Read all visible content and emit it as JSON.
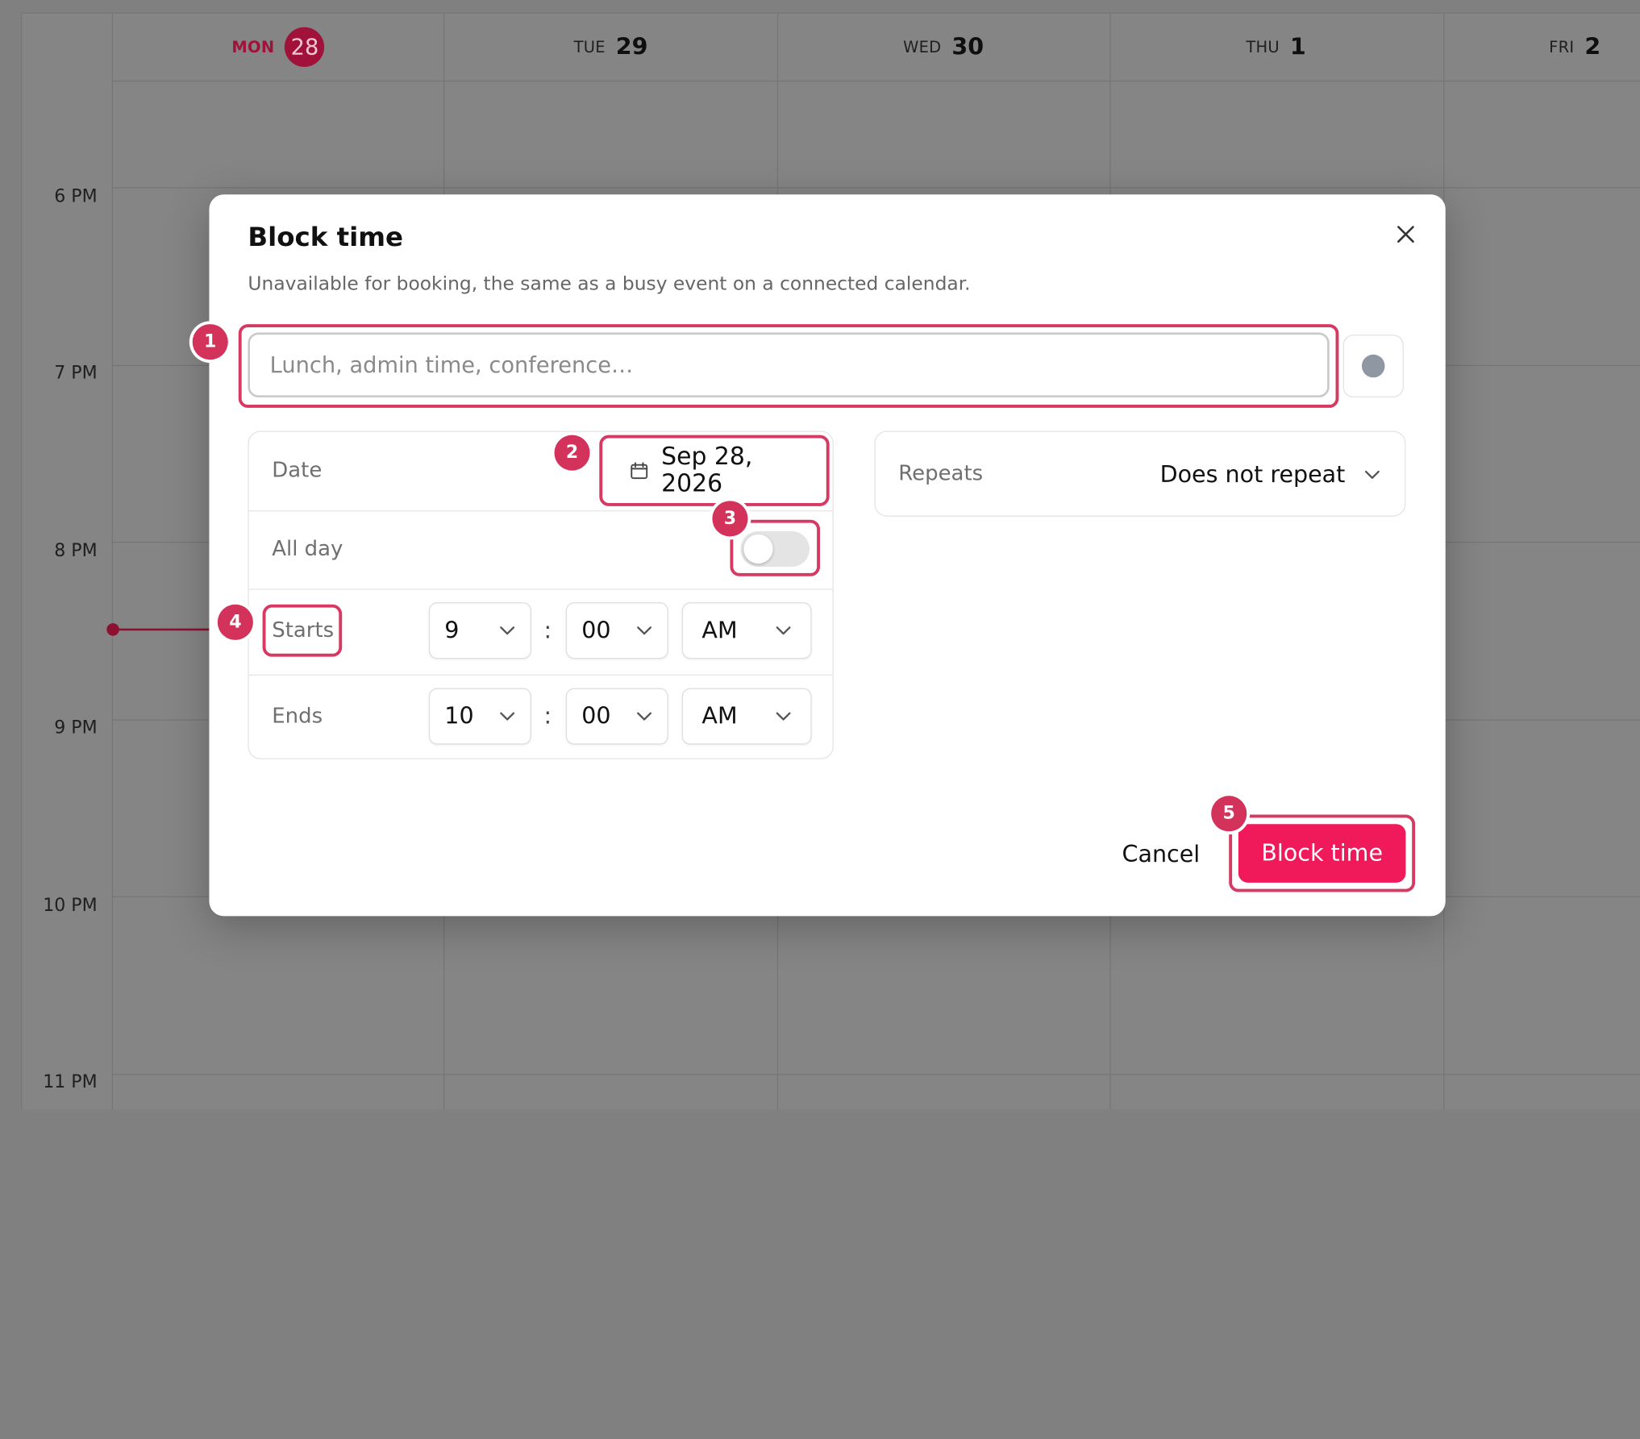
{
  "calendar": {
    "days": [
      {
        "name": "MON",
        "num": "28"
      },
      {
        "name": "TUE",
        "num": "29"
      },
      {
        "name": "WED",
        "num": "30"
      },
      {
        "name": "THU",
        "num": "1"
      },
      {
        "name": "FRI",
        "num": "2"
      }
    ],
    "hours": [
      "6 PM",
      "7 PM",
      "8 PM",
      "9 PM",
      "10 PM",
      "11 PM"
    ]
  },
  "modal": {
    "title": "Block time",
    "description": "Unavailable for booking, the same as a busy event on a connected calendar.",
    "name_input": {
      "value": "",
      "placeholder": "Lunch, admin time, conference…"
    },
    "color": "#8f97a3",
    "date": {
      "label": "Date",
      "value": "Sep 28, 2026"
    },
    "all_day": {
      "label": "All day",
      "on": false
    },
    "starts": {
      "label": "Starts",
      "hour": "9",
      "minute": "00",
      "ampm": "AM"
    },
    "ends": {
      "label": "Ends",
      "hour": "10",
      "minute": "00",
      "ampm": "AM"
    },
    "repeats": {
      "label": "Repeats",
      "value": "Does not repeat"
    },
    "cancel_label": "Cancel",
    "submit_label": "Block time"
  },
  "annotations": {
    "badge1": "1",
    "badge2": "2",
    "badge3": "3",
    "badge4": "4",
    "badge5": "5"
  },
  "colors": {
    "accent": "#f0195a",
    "today": "#a1123a",
    "highlight": "#d63a62"
  },
  "icons": {
    "close": "close-icon",
    "calendar": "calendar-icon",
    "chevron": "chevron-down-icon"
  }
}
